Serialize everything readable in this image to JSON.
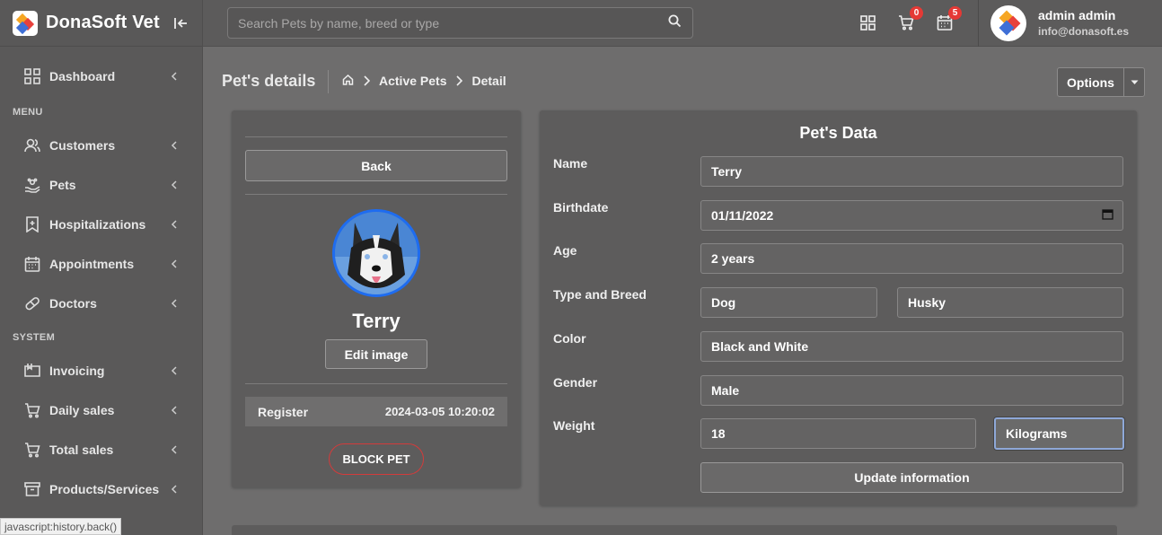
{
  "brand": {
    "name": "DonaSoft Vet",
    "logo_icon": "donasoft-logo-icon"
  },
  "sidebar": {
    "top_items": [
      {
        "label": "Dashboard",
        "icon": "grid-icon"
      }
    ],
    "menu_section": "MENU",
    "menu_items": [
      {
        "label": "Customers",
        "icon": "users-icon"
      },
      {
        "label": "Pets",
        "icon": "hand-paw-icon"
      },
      {
        "label": "Hospitalizations",
        "icon": "bookmark-icon"
      },
      {
        "label": "Appointments",
        "icon": "calendar-icon"
      },
      {
        "label": "Doctors",
        "icon": "pill-icon"
      }
    ],
    "system_section": "SYSTEM",
    "system_items": [
      {
        "label": "Invoicing",
        "icon": "invoice-icon"
      },
      {
        "label": "Daily sales",
        "icon": "cart-icon"
      },
      {
        "label": "Total sales",
        "icon": "cart-icon"
      },
      {
        "label": "Products/Services",
        "icon": "archive-icon"
      }
    ]
  },
  "topbar": {
    "search_placeholder": "Search Pets by name, breed or type",
    "cart_count": "0",
    "calendar_count": "5",
    "user_name": "admin admin",
    "user_email": "info@donasoft.es"
  },
  "page": {
    "title": "Pet's details",
    "breadcrumb": [
      "Active Pets",
      "Detail"
    ],
    "options_label": "Options"
  },
  "pet_card": {
    "back_label": "Back",
    "name": "Terry",
    "edit_image_label": "Edit image",
    "register_label": "Register",
    "register_value": "2024-03-05 10:20:02",
    "block_label": "BLOCK PET"
  },
  "pet_data": {
    "title": "Pet's Data",
    "labels": {
      "name": "Name",
      "birthdate": "Birthdate",
      "age": "Age",
      "type_breed": "Type and Breed",
      "color": "Color",
      "gender": "Gender",
      "weight": "Weight"
    },
    "values": {
      "name": "Terry",
      "birthdate": "01/11/2022",
      "age": "2 years",
      "type": "Dog",
      "breed": "Husky",
      "color": "Black and White",
      "gender": "Male",
      "weight": "18",
      "weight_unit": "Kilograms"
    },
    "update_label": "Update information"
  },
  "status_bar": {
    "text": "javascript:history.back()"
  },
  "colors": {
    "accent_blue": "#1e6cf0",
    "danger_red": "#d33b3b",
    "badge_red": "#e53935"
  }
}
